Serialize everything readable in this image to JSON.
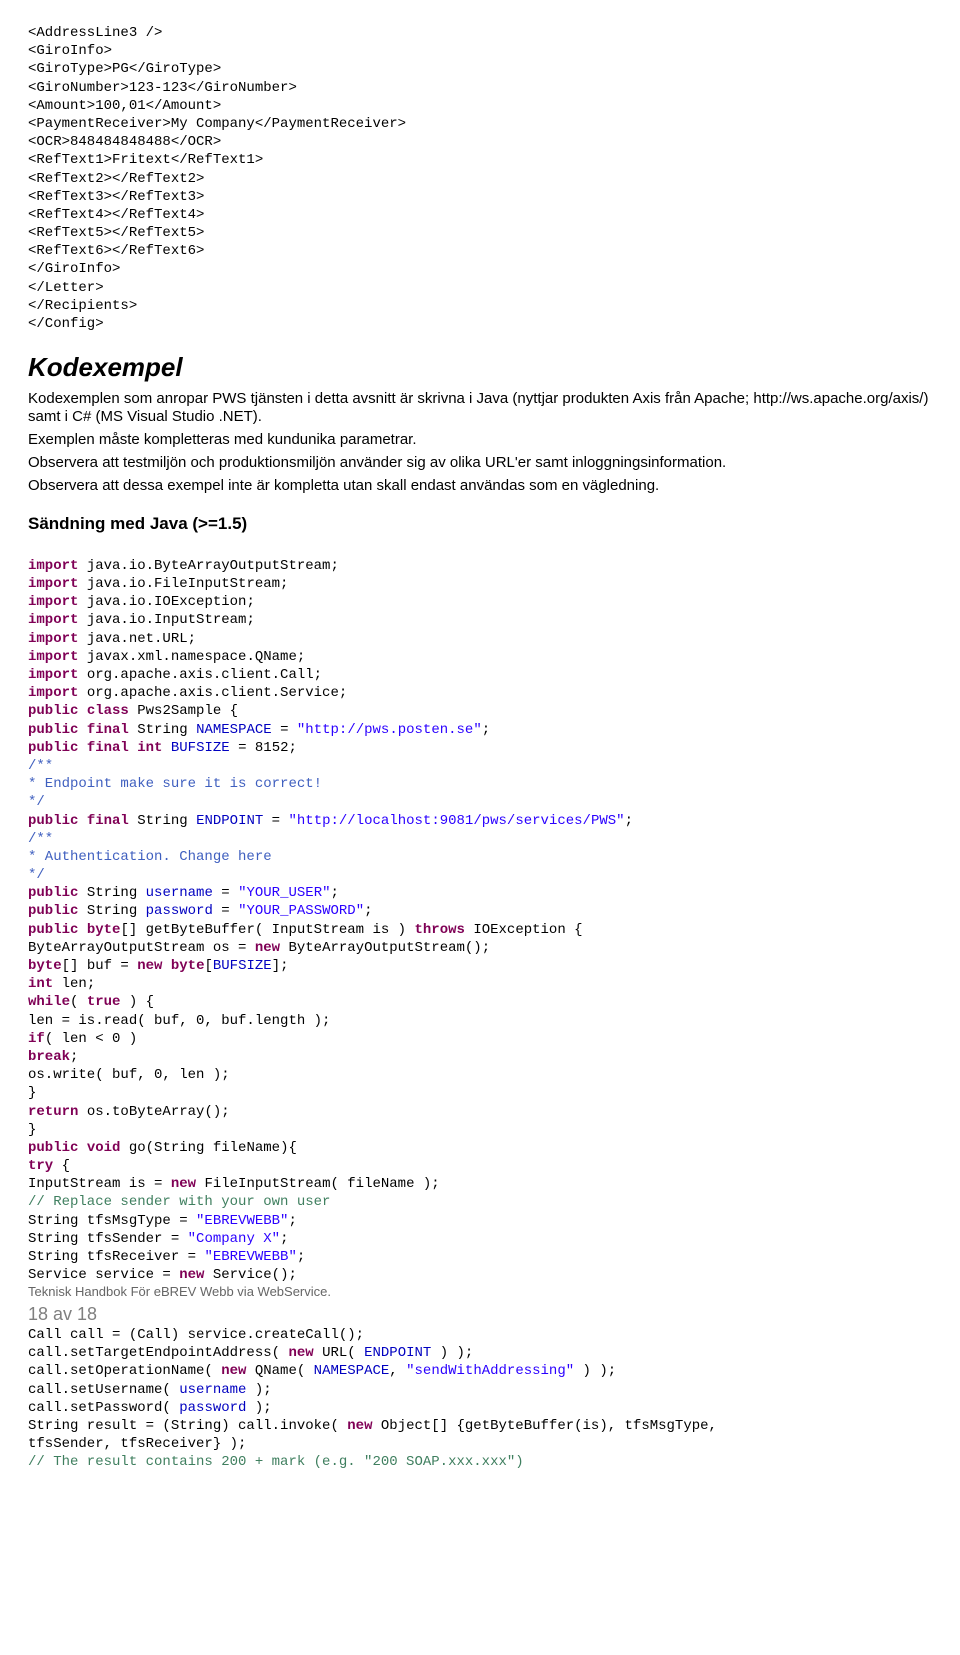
{
  "xml_block": "<AddressLine3 />\n<GiroInfo>\n<GiroType>PG</GiroType>\n<GiroNumber>123-123</GiroNumber>\n<Amount>100,01</Amount>\n<PaymentReceiver>My Company</PaymentReceiver>\n<OCR>848484848488</OCR>\n<RefText1>Fritext</RefText1>\n<RefText2></RefText2>\n<RefText3></RefText3>\n<RefText4></RefText4>\n<RefText5></RefText5>\n<RefText6></RefText6>\n</GiroInfo>\n</Letter>\n</Recipients>\n</Config>",
  "heading_kodexempel": "Kodexempel",
  "para1": "Kodexemplen som anropar PWS tjänsten i detta avsnitt är skrivna i Java (nyttjar produkten Axis från Apache; http://ws.apache.org/axis/) samt i C# (MS Visual Studio .NET).",
  "para2": "Exemplen måste kompletteras med kundunika parametrar.",
  "para3": "Observera att testmiljön och produktionsmiljön använder sig av olika URL'er samt inloggningsinformation.",
  "para4": "Observera att dessa exempel inte är kompletta utan skall endast användas som en vägledning.",
  "heading_java": "Sändning med Java (>=1.5)",
  "code": {
    "l01a": "import",
    "l01b": " java.io.ByteArrayOutputStream;",
    "l02a": "import",
    "l02b": " java.io.FileInputStream;",
    "l03a": "import",
    "l03b": " java.io.IOException;",
    "l04a": "import",
    "l04b": " java.io.InputStream;",
    "l05a": "import",
    "l05b": " java.net.URL;",
    "l06a": "import",
    "l06b": " javax.xml.namespace.QName;",
    "l07a": "import",
    "l07b": " org.apache.axis.client.Call;",
    "l08a": "import",
    "l08b": " org.apache.axis.client.Service;",
    "l09a": "public",
    "l09b": " ",
    "l09c": "class",
    "l09d": " Pws2Sample {",
    "l10a": "public",
    "l10b": " ",
    "l10c": "final",
    "l10d": " String ",
    "l10e": "NAMESPACE",
    "l10f": " = ",
    "l10g": "\"http://pws.posten.se\"",
    "l10h": ";",
    "l11a": "public",
    "l11b": " ",
    "l11c": "final",
    "l11d": " ",
    "l11e": "int",
    "l11f": " ",
    "l11g": "BUFSIZE",
    "l11h": " = 8152;",
    "l12": "/**",
    "l13": "* Endpoint make sure it is correct!",
    "l14": "*/",
    "l15a": "public",
    "l15b": " ",
    "l15c": "final",
    "l15d": " String ",
    "l15e": "ENDPOINT",
    "l15f": " = ",
    "l15g": "\"http://localhost:9081/pws/services/PWS\"",
    "l15h": ";",
    "l16": "/**",
    "l17": "* Authentication. Change here",
    "l18": "*/",
    "l19a": "public",
    "l19b": " String ",
    "l19c": "username",
    "l19d": " = ",
    "l19e": "\"YOUR_USER\"",
    "l19f": ";",
    "l20a": "public",
    "l20b": " String ",
    "l20c": "password",
    "l20d": " = ",
    "l20e": "\"YOUR_PASSWORD\"",
    "l20f": ";",
    "l21a": "public",
    "l21b": " ",
    "l21c": "byte",
    "l21d": "[] getByteBuffer( InputStream is ) ",
    "l21e": "throws",
    "l21f": " IOException {",
    "l22a": "ByteArrayOutputStream os = ",
    "l22b": "new",
    "l22c": " ByteArrayOutputStream();",
    "l23a": "byte",
    "l23b": "[] buf = ",
    "l23c": "new",
    "l23d": " ",
    "l23e": "byte",
    "l23f": "[",
    "l23g": "BUFSIZE",
    "l23h": "];",
    "l24a": "int",
    "l24b": " len;",
    "l25a": "while",
    "l25b": "( ",
    "l25c": "true",
    "l25d": " ) {",
    "l26": "len = is.read( buf, 0, buf.length );",
    "l27a": "if",
    "l27b": "( len < 0 )",
    "l28a": "break",
    "l28b": ";",
    "l29": "os.write( buf, 0, len );",
    "l30": "}",
    "l31a": "return",
    "l31b": " os.toByteArray();",
    "l32": "}",
    "l33a": "public",
    "l33b": " ",
    "l33c": "void",
    "l33d": " go(String fileName){",
    "l34a": "try",
    "l34b": " {",
    "l35a": "InputStream is = ",
    "l35b": "new",
    "l35c": " FileInputStream( fileName );",
    "l36": "// Replace sender with your own user",
    "l37a": "String tfsMsgType = ",
    "l37b": "\"EBREVWEBB\"",
    "l37c": ";",
    "l38a": "String tfsSender = ",
    "l38b": "\"Company X\"",
    "l38c": ";",
    "l39a": "String tfsReceiver = ",
    "l39b": "\"EBREVWEBB\"",
    "l39c": ";",
    "l40a": "Service service = ",
    "l40b": "new",
    "l40c": " Service();",
    "footer_text": "Teknisk Handbok För eBREV Webb via WebService.",
    "pagenum": "18 av 18",
    "l41": "Call call = (Call) service.createCall();",
    "l42a": "call.setTargetEndpointAddress( ",
    "l42b": "new",
    "l42c": " URL( ",
    "l42d": "ENDPOINT",
    "l42e": " ) );",
    "l43a": "call.setOperationName( ",
    "l43b": "new",
    "l43c": " QName( ",
    "l43d": "NAMESPACE",
    "l43e": ", ",
    "l43f": "\"sendWithAddressing\"",
    "l43g": " ) );",
    "l44a": "call.setUsername( ",
    "l44b": "username",
    "l44c": " );",
    "l45a": "call.setPassword( ",
    "l45b": "password",
    "l45c": " );",
    "l46a": "String result = (String) call.invoke( ",
    "l46b": "new",
    "l46c": " Object[] {getByteBuffer(is), tfsMsgType,\ntfsSender, tfsReceiver} );",
    "l47": "// The result contains 200 + mark (e.g. \"200 SOAP.xxx.xxx\")"
  }
}
